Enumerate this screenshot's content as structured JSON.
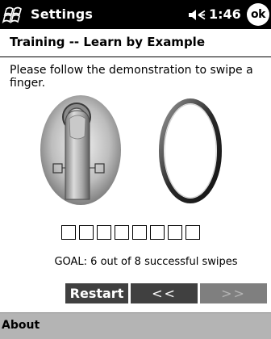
{
  "titlebar": {
    "app_title": "Settings",
    "time": "1:46",
    "ok_label": "ok"
  },
  "page": {
    "title": "Training -- Learn by Example",
    "instructions": "Please follow the demonstration to swipe a finger."
  },
  "training": {
    "swipe_slot_count": 8,
    "goal_text": "GOAL: 6 out of 8 successful swipes"
  },
  "buttons": {
    "restart_label": "Restart",
    "back_label": "<<",
    "forward_label": ">>"
  },
  "menubar": {
    "about_label": "About"
  },
  "icons": {
    "start": "windows-flag-icon",
    "volume": "speaker-volume-icon",
    "demo_finger": "finger-on-sensor-image",
    "demo_ring": "sensor-ring-image"
  },
  "colors": {
    "titlebar_bg": "#000000",
    "button_bg": "#404040",
    "button_disabled_bg": "#7f7f7f",
    "menubar_bg": "#b4b4b4"
  }
}
